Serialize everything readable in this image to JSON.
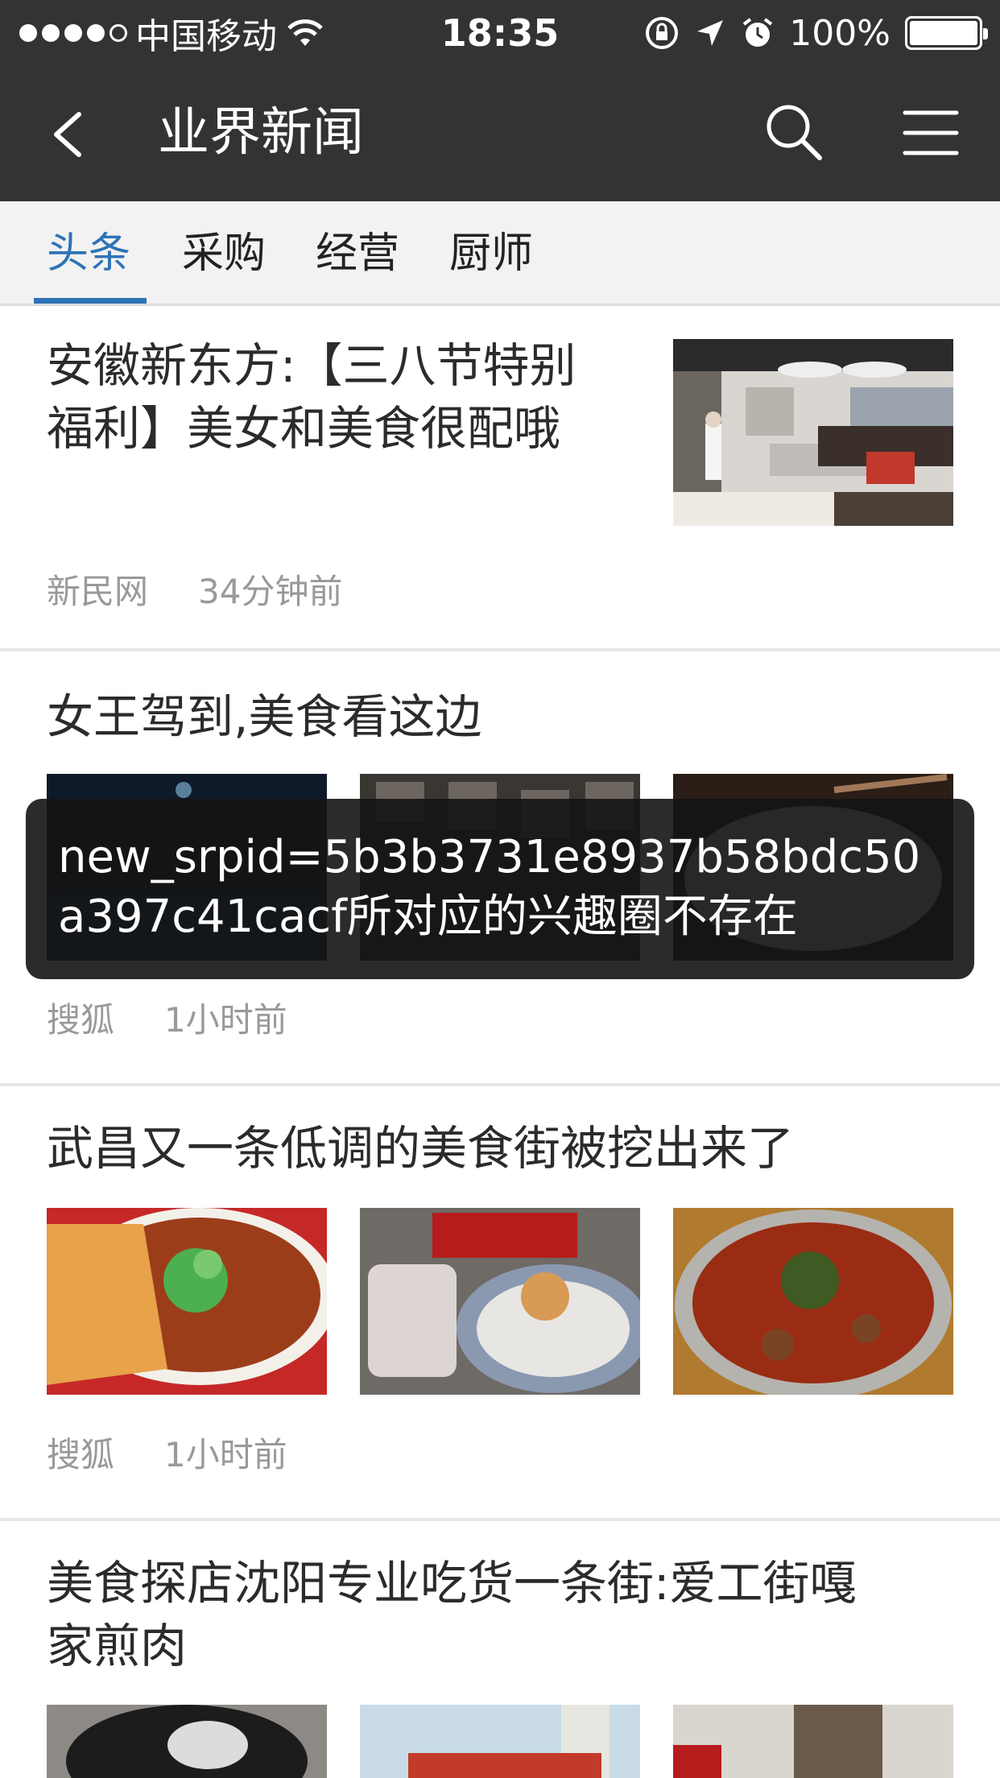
{
  "status_bar": {
    "carrier": "中国移动",
    "time": "18:35",
    "battery": "100%",
    "battery_level": 1.0
  },
  "navbar": {
    "title": "业界新闻",
    "back_icon": "chevron-left-icon",
    "search_icon": "search-icon",
    "menu_icon": "hamburger-menu-icon"
  },
  "tabs": [
    {
      "label": "头条",
      "active": true
    },
    {
      "label": "采购",
      "active": false
    },
    {
      "label": "经营",
      "active": false
    },
    {
      "label": "厨师",
      "active": false
    }
  ],
  "articles": [
    {
      "title_line1": "安徽新东方:【三八节特别",
      "title_line2": "福利】美女和美食很配哦",
      "source": "新民网",
      "time": "34分钟前"
    },
    {
      "title": "女王驾到,美食看这边",
      "source": "搜狐",
      "time": "1小时前"
    },
    {
      "title": "武昌又一条低调的美食街被挖出来了",
      "source": "搜狐",
      "time": "1小时前"
    },
    {
      "title_line1": "美食探店沈阳专业吃货一条街:爱工街嘎",
      "title_line2": "家煎肉"
    }
  ],
  "toast": {
    "message": "new_srpid=5b3b3731e8937b58bdc50a397c41cacf所对应的兴趣圈不存在"
  },
  "colors": {
    "nav_bg": "#333333",
    "accent": "#2d73b6",
    "meta_text": "#999999"
  }
}
